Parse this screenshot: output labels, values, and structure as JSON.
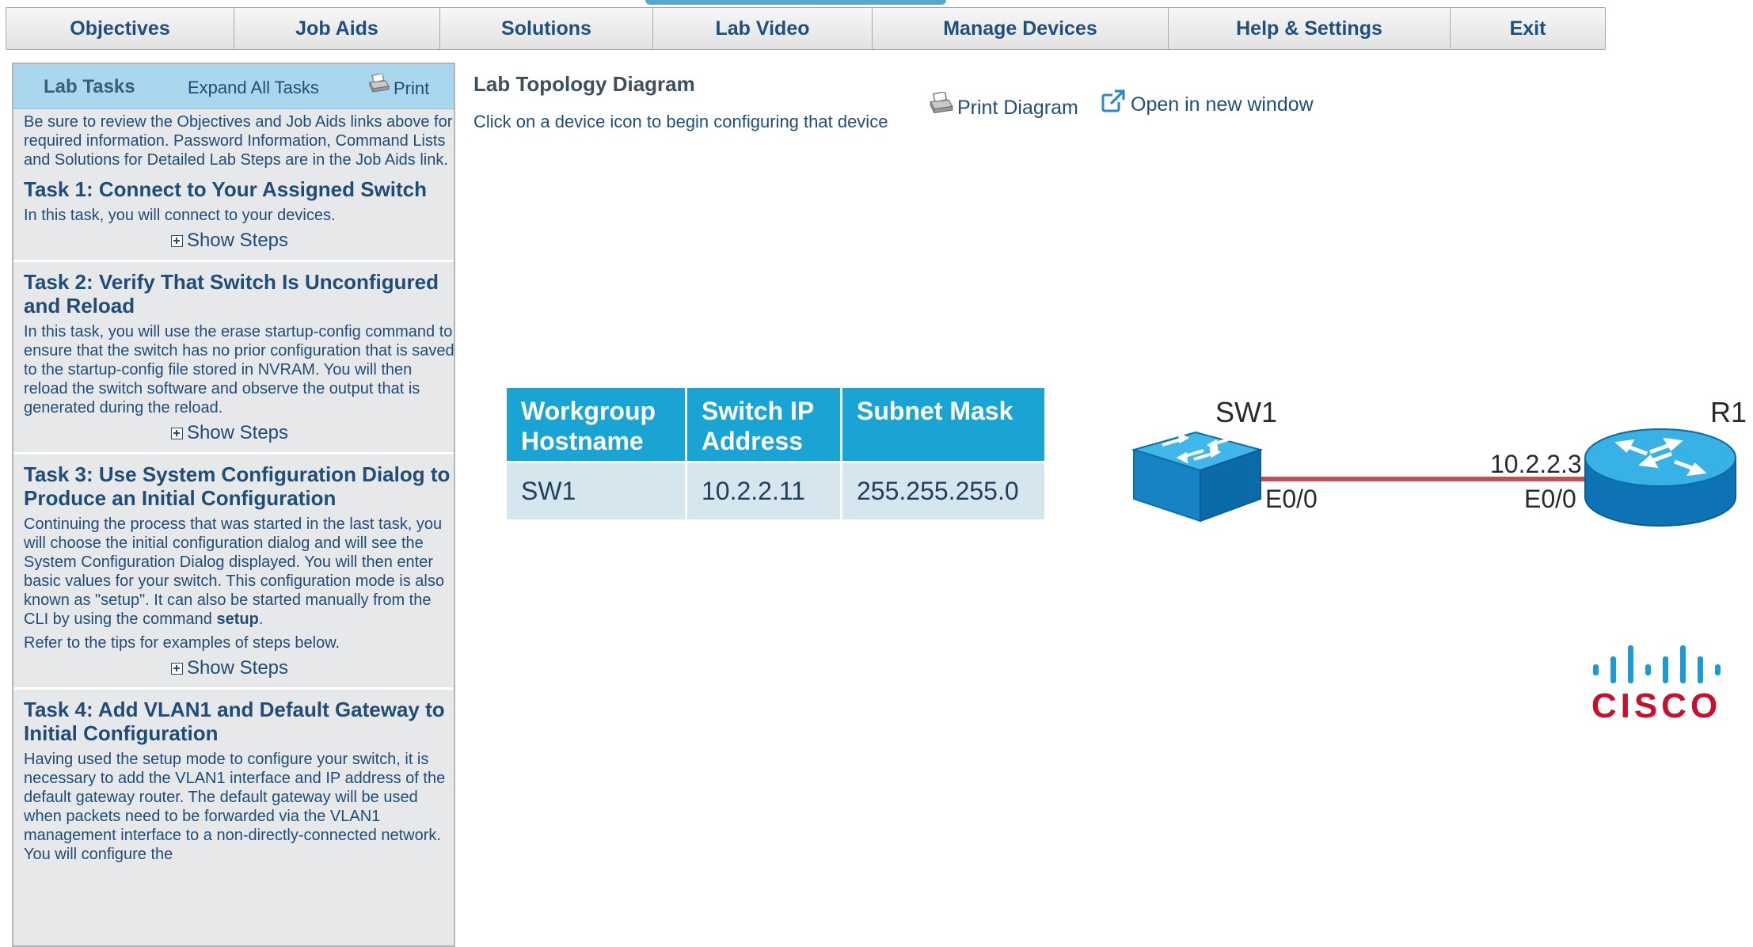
{
  "nav": {
    "items": [
      {
        "label": "Objectives"
      },
      {
        "label": "Job Aids"
      },
      {
        "label": "Solutions"
      },
      {
        "label": "Lab Video"
      },
      {
        "label": "Manage Devices"
      },
      {
        "label": "Help & Settings"
      },
      {
        "label": "Exit"
      }
    ]
  },
  "panel": {
    "title": "Lab Tasks",
    "expand_all": "Expand All Tasks",
    "print": "Print",
    "intro": "Be sure to review the Objectives and Job Aids links above for required information. Password Information, Command Lists and Solutions for Detailed Lab Steps are in the Job Aids link.",
    "show_steps": "Show Steps",
    "tasks": [
      {
        "title": "Task 1: Connect to Your Assigned Switch",
        "desc": "In this task, you will connect to your devices."
      },
      {
        "title": "Task 2: Verify That Switch Is Unconfigured and Reload",
        "desc": "In this task, you will use the erase startup-config command to ensure that the switch has no prior configuration that is saved to the startup-config file stored in NVRAM. You will then reload the switch software and observe the output that is generated during the reload."
      },
      {
        "title": "Task 3: Use System Configuration Dialog to Produce an Initial Configuration",
        "desc_before": "Continuing the process that was started in the last task, you will choose the initial configuration dialog and will see the System Configuration Dialog displayed. You will then enter basic values for your switch. This configuration mode is also known as \"setup\". It can also be started manually from the CLI by using the command ",
        "desc_command": "setup",
        "desc_after": ".",
        "tip": "Refer to the tips for examples of steps below."
      },
      {
        "title": "Task 4: Add VLAN1 and Default Gateway to Initial Configuration",
        "desc": "Having used the setup mode to configure your switch, it is necessary to add the VLAN1 interface and IP address of the default gateway router. The default gateway will be used when packets need to be forwarded via the VLAN1 management interface to a non-directly-connected network. You will configure the"
      }
    ]
  },
  "main": {
    "title": "Lab Topology Diagram",
    "instructions": "Click on a device icon to begin configuring that device",
    "print_diagram": "Print Diagram",
    "open_new_window": "Open in new window"
  },
  "table": {
    "headers": [
      {
        "line1": "Workgroup",
        "line2": "Hostname"
      },
      {
        "line1": "Switch IP",
        "line2": "Address"
      },
      {
        "line1": "Subnet Mask",
        "line2": ""
      }
    ],
    "rows": [
      {
        "hostname": "SW1",
        "ip": "10.2.2.11",
        "mask": "255.255.255.0"
      }
    ]
  },
  "topology": {
    "switch_name": "SW1",
    "switch_port": "E0/0",
    "router_name": "R1",
    "router_ip": "10.2.2.3",
    "router_port": "E0/0",
    "link_color": "#c0504d",
    "device_color": "#1b9ad6"
  },
  "logo": {
    "text": "CISCO",
    "color_bars": "#1b9ad6",
    "color_text": "#c8102e"
  }
}
